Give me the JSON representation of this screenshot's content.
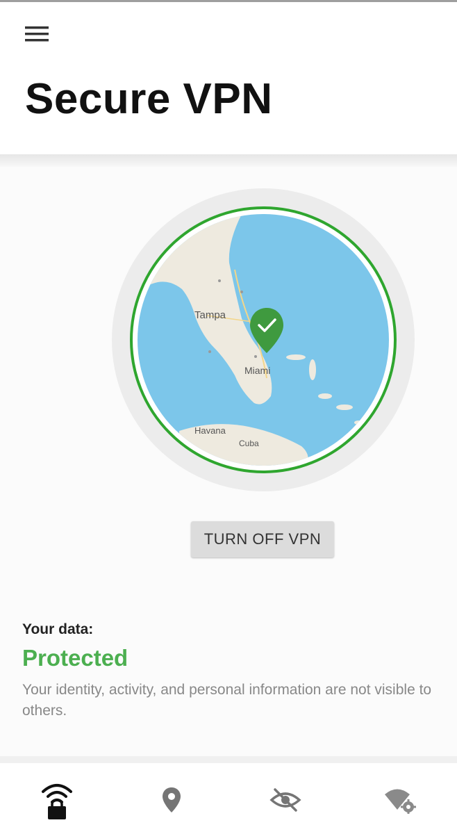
{
  "header": {
    "title": "Secure VPN",
    "menu_icon": "hamburger-menu-icon"
  },
  "map": {
    "labels": [
      {
        "id": "tampa",
        "text": "Tampa"
      },
      {
        "id": "miami",
        "text": "Miami"
      },
      {
        "id": "havana",
        "text": "Havana"
      },
      {
        "id": "cuba",
        "text": "Cuba"
      }
    ],
    "marker_icon": "location-check-pin-icon",
    "ring_color": "#2fa62f",
    "water_color": "#7cc6ea",
    "land_color": "#eeeadf"
  },
  "vpn": {
    "toggle_label": "TURN OFF VPN"
  },
  "status": {
    "label": "Your data:",
    "value": "Protected",
    "description": "Your identity, activity, and personal information are not visible to others.",
    "color": "#4caf50"
  },
  "bottom_nav": {
    "items": [
      {
        "id": "vpn",
        "icon": "wifi-lock-icon"
      },
      {
        "id": "location",
        "icon": "location-pin-icon"
      },
      {
        "id": "privacy",
        "icon": "eye-off-icon"
      },
      {
        "id": "wifi-settings",
        "icon": "wifi-settings-icon"
      }
    ]
  }
}
